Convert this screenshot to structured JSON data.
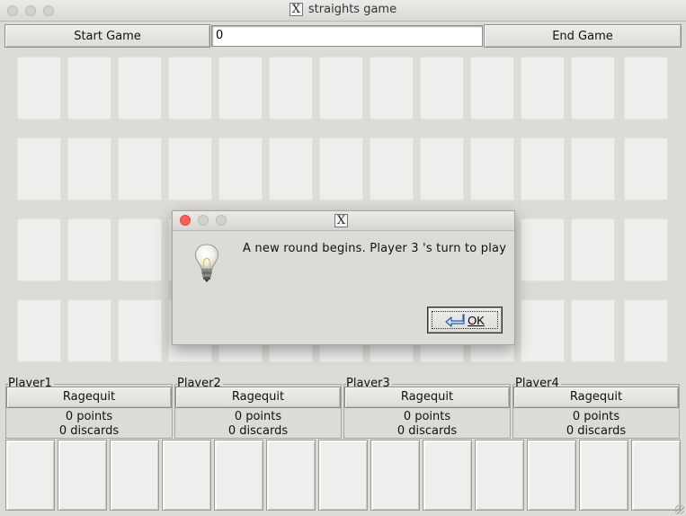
{
  "window": {
    "title": "straights game",
    "app_icon": "x11-icon"
  },
  "toolbar": {
    "start_label": "Start Game",
    "seed_value": "0",
    "end_label": "End Game"
  },
  "table": {
    "rows": 4,
    "cols": 13
  },
  "players": [
    {
      "name": "Player1",
      "rage_label": "Ragequit",
      "points": "0 points",
      "discards": "0 discards"
    },
    {
      "name": "Player2",
      "rage_label": "Ragequit",
      "points": "0 points",
      "discards": "0 discards"
    },
    {
      "name": "Player3",
      "rage_label": "Ragequit",
      "points": "0 points",
      "discards": "0 discards"
    },
    {
      "name": "Player4",
      "rage_label": "Ragequit",
      "points": "0 points",
      "discards": "0 discards"
    }
  ],
  "hand": {
    "slots": 13
  },
  "dialog": {
    "title_icon": "x11-icon",
    "icon": "lightbulb-icon",
    "message": "A new round begins. Player 3 's turn to play",
    "ok_label": "OK"
  }
}
